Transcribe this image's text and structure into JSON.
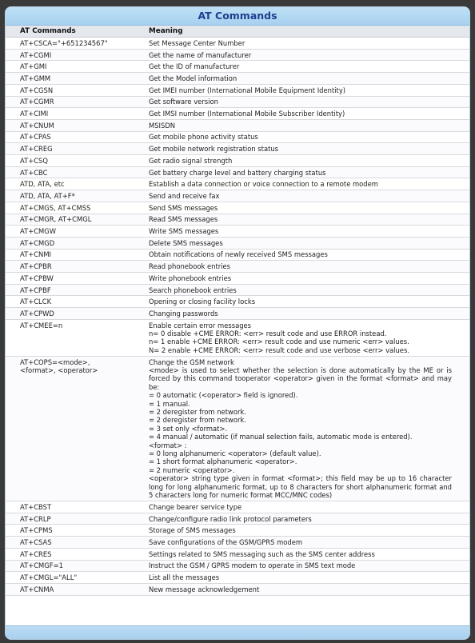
{
  "table": {
    "title": "AT Commands",
    "headers": [
      "AT Commands",
      "Meaning"
    ],
    "rows": [
      {
        "cmd": [
          "AT+CSCA=\"+651234567\""
        ],
        "meaning": [
          "Set Message Center Number"
        ]
      },
      {
        "cmd": [
          "AT+CGMI"
        ],
        "meaning": [
          "Get the name of manufacturer"
        ]
      },
      {
        "cmd": [
          "AT+GMI"
        ],
        "meaning": [
          "Get the ID of manufacturer"
        ]
      },
      {
        "cmd": [
          "AT+GMM"
        ],
        "meaning": [
          "Get the Model information"
        ]
      },
      {
        "cmd": [
          "AT+CGSN"
        ],
        "meaning": [
          "Get IMEI number (International Mobile Equipment Identity)"
        ]
      },
      {
        "cmd": [
          "AT+CGMR"
        ],
        "meaning": [
          "Get software version"
        ]
      },
      {
        "cmd": [
          "AT+CIMI"
        ],
        "meaning": [
          "Get IMSI number (International Mobile Subscriber Identity)"
        ]
      },
      {
        "cmd": [
          "AT+CNUM"
        ],
        "meaning": [
          "MSISDN"
        ]
      },
      {
        "cmd": [
          "AT+CPAS"
        ],
        "meaning": [
          "Get mobile phone activity status"
        ]
      },
      {
        "cmd": [
          "AT+CREG"
        ],
        "meaning": [
          "Get mobile network registration status"
        ]
      },
      {
        "cmd": [
          "AT+CSQ"
        ],
        "meaning": [
          "Get radio signal strength"
        ]
      },
      {
        "cmd": [
          "AT+CBC"
        ],
        "meaning": [
          "Get battery charge level and battery charging status"
        ]
      },
      {
        "cmd": [
          "ATD, ATA, etc"
        ],
        "meaning": [
          "Establish a data connection or voice connection to a remote modem"
        ]
      },
      {
        "cmd": [
          "ATD, ATA, AT+F*"
        ],
        "meaning": [
          "Send and receive fax"
        ]
      },
      {
        "cmd": [
          "AT+CMGS, AT+CMSS"
        ],
        "meaning": [
          "Send SMS messages"
        ]
      },
      {
        "cmd": [
          "AT+CMGR, AT+CMGL"
        ],
        "meaning": [
          "Read SMS messages"
        ]
      },
      {
        "cmd": [
          "AT+CMGW"
        ],
        "meaning": [
          "Write SMS messages"
        ]
      },
      {
        "cmd": [
          "AT+CMGD"
        ],
        "meaning": [
          "Delete SMS messages"
        ]
      },
      {
        "cmd": [
          "AT+CNMI"
        ],
        "meaning": [
          "Obtain notifications of newly received SMS messages"
        ]
      },
      {
        "cmd": [
          "AT+CPBR"
        ],
        "meaning": [
          "Read phonebook entries"
        ]
      },
      {
        "cmd": [
          "AT+CPBW"
        ],
        "meaning": [
          "Write phonebook entries"
        ]
      },
      {
        "cmd": [
          "AT+CPBF"
        ],
        "meaning": [
          "Search phonebook entries"
        ]
      },
      {
        "cmd": [
          "AT+CLCK"
        ],
        "meaning": [
          "Opening or closing facility locks"
        ]
      },
      {
        "cmd": [
          "AT+CPWD"
        ],
        "meaning": [
          "Changing passwords"
        ]
      },
      {
        "cmd": [
          "AT+CMEE=n"
        ],
        "meaning": [
          "Enable certain error messages",
          "n= 0 disable +CME ERROR: <err> result code and use ERROR instead.",
          "n= 1 enable +CME ERROR: <err> result code and use numeric <err> values.",
          "N= 2 enable +CME ERROR: <err> result code and use verbose <err> values."
        ]
      },
      {
        "cmd": [
          "AT+COPS=<mode>,",
          "<format>, <operator>"
        ],
        "meaning": [
          "Change the GSM network",
          "<mode> is used to select whether the selection is done automatically by the ME or is forced by this command tooperator <operator> given in the format <format> and may be:",
          "= 0 automatic (<operator> field is ignored).",
          "= 1 manual.",
          "= 2 deregister from network.",
          "= 2 deregister from network.",
          "= 3 set only <format>.",
          "= 4 manual / automatic (if manual selection fails, automatic mode is entered).",
          "<format> :",
          "= 0 long alphanumeric <operator> (default value).",
          "= 1 short format alphanumeric <operator>.",
          "= 2 numeric <operator>.",
          "<operator> string type given in format <format>; this field may be up to 16 character long for long alphanumeric format, up to 8 characters for short alphanumeric format and 5 characters long for numeric format MCC/MNC codes)"
        ]
      },
      {
        "cmd": [
          "AT+CBST"
        ],
        "meaning": [
          "Change bearer service type"
        ]
      },
      {
        "cmd": [
          "AT+CRLP"
        ],
        "meaning": [
          "Change/configure radio link protocol parameters"
        ]
      },
      {
        "cmd": [
          "AT+CPMS"
        ],
        "meaning": [
          "Storage of SMS messages"
        ]
      },
      {
        "cmd": [
          "AT+CSAS"
        ],
        "meaning": [
          "Save configurations of the GSM/GPRS modem"
        ]
      },
      {
        "cmd": [
          "AT+CRES"
        ],
        "meaning": [
          "Settings related to SMS messaging such as the SMS center address"
        ]
      },
      {
        "cmd": [
          "AT+CMGF=1"
        ],
        "meaning": [
          "Instruct the GSM / GPRS modem to operate in SMS text mode"
        ]
      },
      {
        "cmd": [
          "AT+CMGL=\"ALL\""
        ],
        "meaning": [
          "List all the messages"
        ]
      },
      {
        "cmd": [
          "AT+CNMA"
        ],
        "meaning": [
          "New message acknowledgement"
        ]
      }
    ]
  }
}
